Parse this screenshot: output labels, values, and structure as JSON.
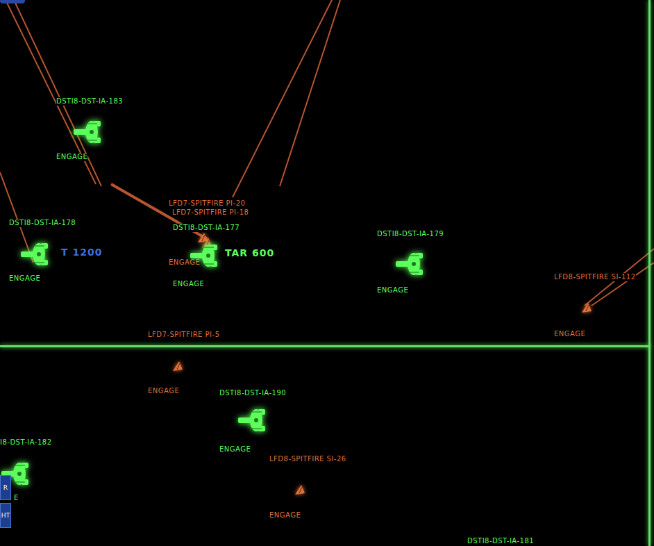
{
  "units": [
    {
      "name": "DSTI8-DST-IA-183",
      "order": "ENGAGE",
      "kind": "cruiser",
      "color": "#5cff5c"
    },
    {
      "name": "DSTI8-DST-IA-178",
      "order": "ENGAGE",
      "kind": "cruiser",
      "color": "#5cff5c"
    },
    {
      "name": "LFD7-SPITFIRE PI-20",
      "order": "ENGAGE",
      "kind": "fighter",
      "color": "#e0703a"
    },
    {
      "name": "LFD7-SPITFIRE PI-18",
      "order": "",
      "kind": "fighter",
      "color": "#e0703a"
    },
    {
      "name": "DSTI8-DST-IA-177",
      "order": "ENGAGE",
      "kind": "cruiser",
      "color": "#5cff5c"
    },
    {
      "name": "DSTI8-DST-IA-179",
      "order": "ENGAGE",
      "kind": "cruiser",
      "color": "#5cff5c"
    },
    {
      "name": "LFD8-SPITFIRE SI-112",
      "order": "ENGAGE",
      "kind": "fighter",
      "color": "#e0703a"
    },
    {
      "name": "LFD7-SPITFIRE PI-5",
      "order": "ENGAGE",
      "kind": "fighter",
      "color": "#e0703a"
    },
    {
      "name": "DSTI8-DST-IA-190",
      "order": "ENGAGE",
      "kind": "cruiser",
      "color": "#5cff5c"
    },
    {
      "name": "I8-DST-IA-182",
      "order": "E",
      "kind": "cruiser",
      "color": "#5cff5c"
    },
    {
      "name": "LFD8-SPITFIRE SI-26",
      "order": "ENGAGE",
      "kind": "fighter",
      "color": "#e0703a"
    },
    {
      "name": "DSTI8-DST-IA-181",
      "order": "",
      "kind": "cruiser",
      "color": "#5cff5c"
    }
  ],
  "readouts": [
    {
      "text": "T 1200",
      "color": "#3d6fe0"
    },
    {
      "text": "TAR 600",
      "color": "#5cff5c"
    }
  ],
  "side_buttons": [
    "R",
    "HT"
  ]
}
